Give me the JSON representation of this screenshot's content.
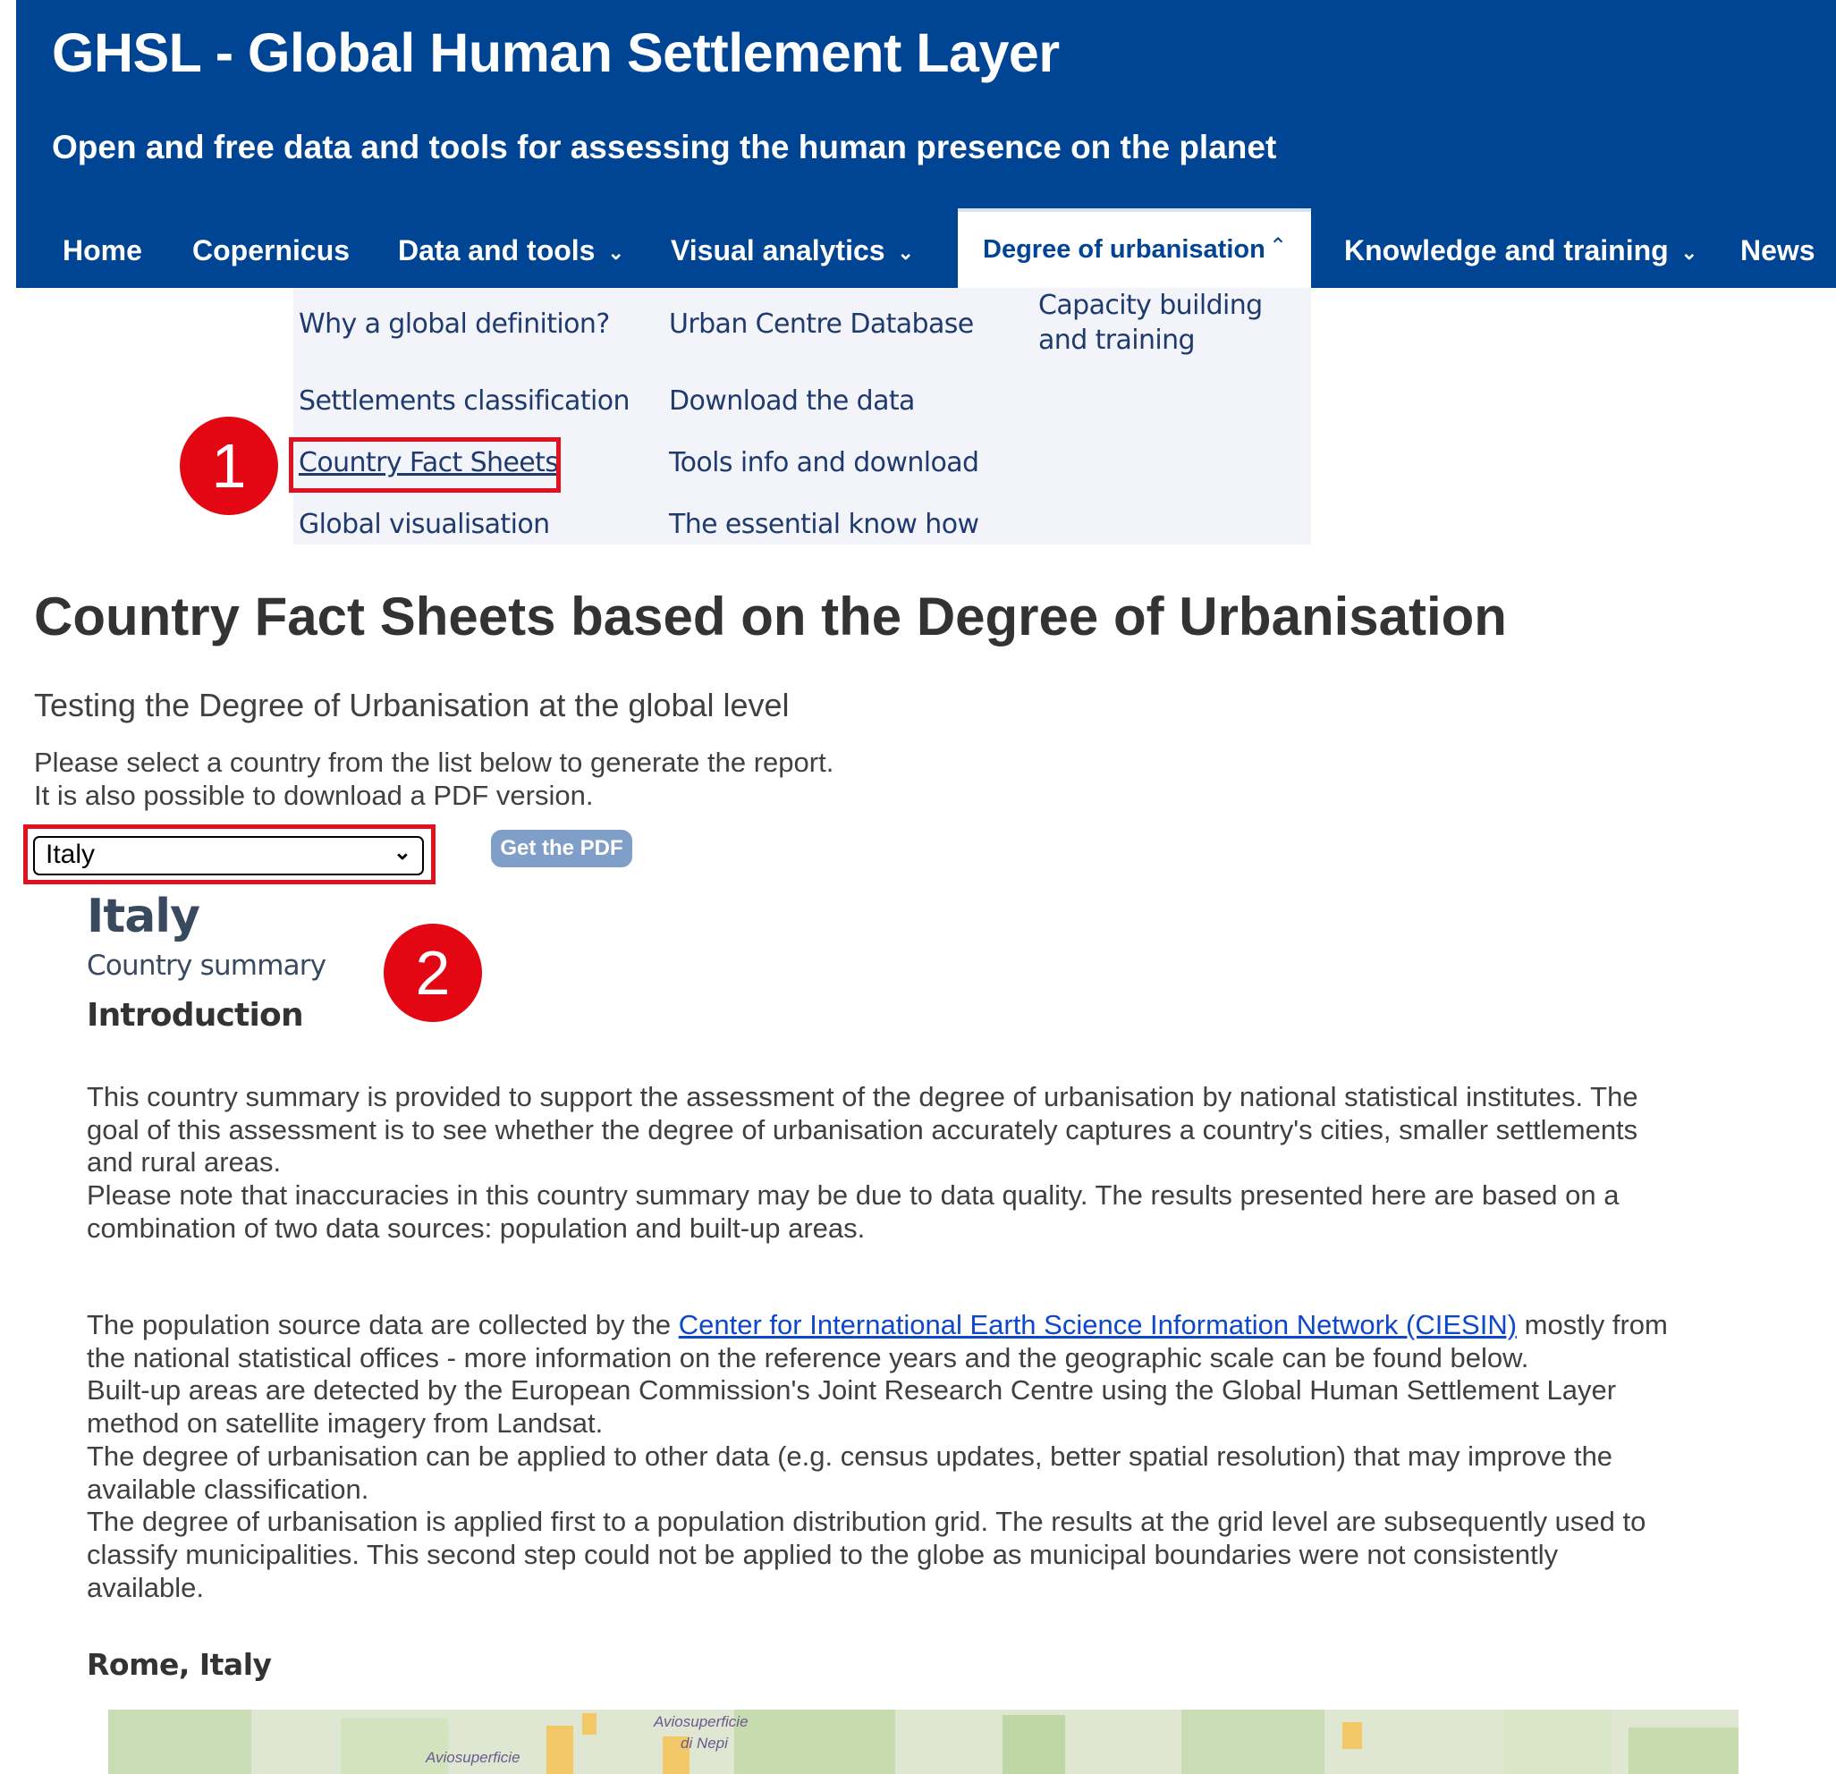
{
  "header": {
    "title": "GHSL - Global Human Settlement Layer",
    "subtitle": "Open and free data and tools for assessing the human presence on the planet"
  },
  "nav": {
    "home": "Home",
    "copernicus": "Copernicus",
    "data_tools": "Data and tools",
    "visual_analytics": "Visual analytics",
    "degree_urbanisation": "Degree of urbanisation",
    "knowledge_training": "Knowledge and training",
    "news": "News"
  },
  "dropdown": {
    "why_global": "Why a global definition?",
    "settlements_classification": "Settlements classification",
    "country_fact_sheets": "Country Fact Sheets",
    "global_visualisation": "Global visualisation",
    "urban_centre_database": "Urban Centre Database",
    "download_data": "Download the data",
    "tools_info": "Tools info and download",
    "essential_know_how": "The essential know how",
    "capacity_building": "Capacity building and training"
  },
  "callouts": {
    "one": "1",
    "two": "2"
  },
  "main": {
    "title": "Country Fact Sheets based on the Degree of Urbanisation",
    "lead": "Testing the Degree of Urbanisation at the global level",
    "instruction_1": "Please select a country from the list below to generate the report.",
    "instruction_2": "It is also possible to download a PDF version.",
    "country_select_value": "Italy",
    "pdf_button": "Get the PDF"
  },
  "report": {
    "country": "Italy",
    "summary_label": "Country summary",
    "intro_heading": "Introduction",
    "intro_p1": [
      "This country summary is provided to support the assessment of the degree of urbanisation by national statistical institutes. The",
      "goal of this assessment is to see whether the degree of urbanisation accurately captures a country's cities, smaller settlements",
      "and rural areas.",
      "Please note that inaccuracies in this country summary may be due to data quality. The results presented here are based on a",
      "combination of two data sources: population and built-up areas."
    ],
    "p2_prefix": "The population source data are collected by the ",
    "p2_link": "Center for International Earth Science Information Network (CIESIN)",
    "p2_suffix": " mostly from",
    "p2_lines": [
      "the national statistical offices - more information on the reference years and the geographic scale can be found below.",
      "Built-up areas are detected by the European Commission's Joint Research Centre using the Global Human Settlement Layer",
      "method on satellite imagery from Landsat.",
      "The degree of urbanisation can be applied to other data (e.g. census updates, better spatial resolution) that may improve the",
      "available classification.",
      "The degree of urbanisation is applied first to a population distribution grid. The results at the grid level are subsequently used to",
      "classify municipalities. This second step could not be applied to the globe as municipal boundaries were not consistently",
      "available."
    ],
    "city_heading": "Rome, Italy",
    "map_labels": [
      "Aviosuperficie",
      "Aviosuperficie",
      "di Nepi"
    ]
  }
}
